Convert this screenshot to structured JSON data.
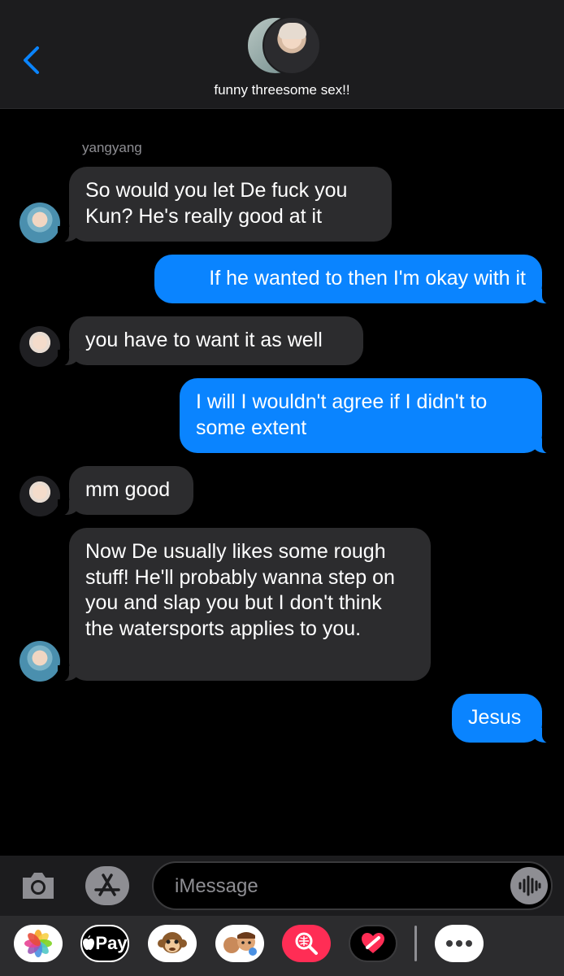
{
  "header": {
    "title": "funny threesome sex!!",
    "back_icon": "chevron-left-icon",
    "accent_color": "#0a84ff"
  },
  "chat": {
    "sender_name": "yangyang",
    "messages": [
      {
        "direction": "incoming",
        "text": "So would you let De fuck you Kun? He's really good at it"
      },
      {
        "direction": "outgoing",
        "text": "If he wanted to then I'm okay with it"
      },
      {
        "direction": "incoming",
        "text": "you have to want it as well"
      },
      {
        "direction": "outgoing",
        "text": "I will I wouldn't agree if I didn't to some extent"
      },
      {
        "direction": "incoming",
        "text": "mm good"
      },
      {
        "direction": "incoming",
        "text": "Now De usually likes some rough stuff! He'll probably wanna step on you and slap you but I don't think the watersports applies to you."
      },
      {
        "direction": "outgoing",
        "text": "Jesus"
      }
    ],
    "colors": {
      "incoming_bubble": "#2c2c2e",
      "outgoing_bubble": "#0a84ff"
    }
  },
  "composer": {
    "placeholder": "iMessage",
    "icons": [
      "camera-icon",
      "app-store-icon",
      "audio-waveform-icon"
    ]
  },
  "app_strip": {
    "apple_pay_label": "Pay",
    "apps": [
      "photos-icon",
      "apple-pay-icon",
      "monkey-animoji-icon",
      "memoji-stickers-icon",
      "web-search-icon",
      "digital-touch-icon",
      "more-apps-icon"
    ]
  }
}
